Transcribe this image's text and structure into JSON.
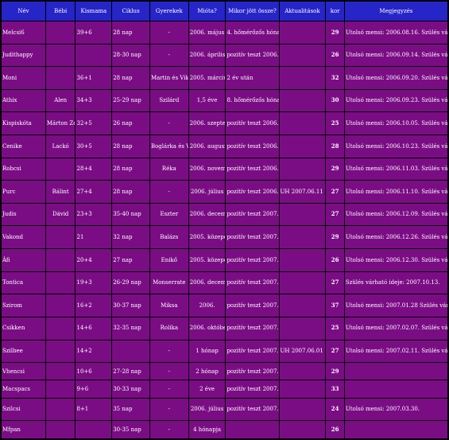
{
  "headers": [
    "Név",
    "Bébi",
    "Kismama",
    "Ciklus",
    "Gyerekek",
    "Mióta?",
    "Mikor jött össze?",
    "Aktualitások",
    "kor",
    "Megjegyzés"
  ],
  "rows": [
    {
      "nev": "Melcsi6",
      "bebi": "",
      "kismama": "39+6",
      "ciklus": "28 nap",
      "gyerekek": "-",
      "miota": "2006. május",
      "mikor": "4. hőmérőzős hónapban",
      "aktualitasok": "",
      "kor": "29",
      "megjegyzes": "Utolsó mensi: 2006.08.16. Szülés várható ideje: 2007.05.23."
    },
    {
      "nev": "Judithappy",
      "bebi": "",
      "kismama": "",
      "ciklus": "28-30 nap",
      "gyerekek": "-",
      "miota": "2006. április",
      "mikor": "pozitív teszt 2006.10.16",
      "aktualitasok": "",
      "kor": "26",
      "megjegyzes": "Utolsó mensi: 2006.09.14. Szülés várható ideje: 2007.06.21."
    },
    {
      "nev": "Moni",
      "bebi": "",
      "kismama": "36+1",
      "ciklus": "28 nap",
      "gyerekek": "Martin és Viki",
      "miota": "2005. március",
      "mikor": "2 év után",
      "aktualitasok": "",
      "kor": "32",
      "megjegyzes": "Utolsó mensi: 2006.09.20. Szülés várható ideje: 2007.06.27."
    },
    {
      "nev": "Athix",
      "bebi": "Alen",
      "kismama": "34+3",
      "ciklus": "25-29 nap",
      "gyerekek": "Szilárd",
      "miota": "1,5 éve",
      "mikor": "8. hőmérőzős hónapban",
      "aktualitasok": "",
      "kor": "30",
      "megjegyzes": "Utolsó mensi: 2006.09.23. Szülés várható ideje: 2007.06.30."
    },
    {
      "nev": "Kispiskóta",
      "bebi": "Márton Zétény",
      "kismama": "32+5",
      "ciklus": "26 nap",
      "gyerekek": "-",
      "miota": "2006. szeptember",
      "mikor": "pozitív teszt 2006.10.30",
      "aktualitasok": "",
      "kor": "25",
      "megjegyzes": "Utolsó mensi: 2006.10.05. Szülés várható ideje: 2007.07.12"
    },
    {
      "nev": "Cenike",
      "bebi": "Lackó",
      "kismama": "30+5",
      "ciklus": "28 nap",
      "gyerekek": "Boglárka és Viola",
      "miota": "2006. augusztus",
      "mikor": "pozitív teszt 2006.11.19.",
      "aktualitasok": "",
      "kor": "28",
      "megjegyzes": "Utolsó mensi: 2006.10.23. Szülés várható ideje: 2007.07.30."
    },
    {
      "nev": "Robcsi",
      "bebi": "",
      "kismama": "28+4",
      "ciklus": "28 nap",
      "gyerekek": "Réka",
      "miota": "2006. november",
      "mikor": "pozitív teszt 2006.12.02.",
      "aktualitasok": "",
      "kor": "29",
      "megjegyzes": "Utolsó mensi: 2006.11.03. Szülés várható ideje:2007.08.10."
    },
    {
      "nev": "Purc",
      "bebi": "Bálint",
      "kismama": "27+4",
      "ciklus": "28 nap",
      "gyerekek": "-",
      "miota": "2006. július",
      "mikor": "pozitív teszt 2006.12.09.",
      "aktualitasok": "UH 2007.06.11",
      "kor": "27",
      "megjegyzes": "Utolsó mensi: 2006.11.10. Szülés várható ideje:2007.08.17."
    },
    {
      "nev": "Judis",
      "bebi": "Dávid",
      "kismama": "23+3",
      "ciklus": "35-40 nap",
      "gyerekek": "Eszter",
      "miota": "2006. december",
      "mikor": "pozitív teszt 2007.01.09.",
      "aktualitasok": "",
      "kor": "27",
      "megjegyzes": "Utolsó mensi: 2006.12.09. Szülés várható ideje: 2007.09.15."
    },
    {
      "nev": "Vakond",
      "bebi": "",
      "kismama": "21",
      "ciklus": "32 nap",
      "gyerekek": "Balázs",
      "miota": "2005. közepe",
      "mikor": "pozitív teszt 2007.01.31.",
      "aktualitasok": "",
      "kor": "29",
      "megjegyzes": "Utolsó mensi: 2006.12.26. Szülés várható ideje: 2007.10.02."
    },
    {
      "nev": "Áfi",
      "bebi": "",
      "kismama": "20+4",
      "ciklus": "27 nap",
      "gyerekek": "Enikő",
      "miota": "2005. közepe",
      "mikor": "pozitív teszt 2007.01.30.",
      "aktualitasok": "",
      "kor": "26",
      "megjegyzes": "Utolsó mensi: 2006.12.30. Szülés várható ideje: 2007.10.06."
    },
    {
      "nev": "Tontica",
      "bebi": "",
      "kismama": "19+3",
      "ciklus": "26-29 nap",
      "gyerekek": "Monserrate",
      "miota": "2006. december",
      "mikor": "pozitív teszt 2007.02.02.",
      "aktualitasok": "",
      "kor": "27",
      "megjegyzes": "Szülés várható ideje: 2007.10.13."
    },
    {
      "nev": "Szirom",
      "bebi": "",
      "kismama": "16+2",
      "ciklus": "30-37 nap",
      "gyerekek": "Miksa",
      "miota": "2006.",
      "mikor": "pozitív teszt 2007.02.24",
      "aktualitasok": "",
      "kor": "37",
      "megjegyzes": "Utolsó mensi: 2007.01.28 Szülés várható ideje: 2007.11.04"
    },
    {
      "nev": "Csikken",
      "bebi": "",
      "kismama": "14+6",
      "ciklus": "32-35 nap",
      "gyerekek": "Rolika",
      "miota": "2006. október",
      "mikor": "pozitív teszt 2007.03.10",
      "aktualitasok": "",
      "kor": "25",
      "megjegyzes": "Utolsó mensi: 2007.02.07. Szülés várható ideje: 2007.11.14"
    },
    {
      "nev": "Szilbee",
      "bebi": "",
      "kismama": "14+2",
      "ciklus": "",
      "gyerekek": "-",
      "miota": "1 hónap",
      "mikor": "pozitív teszt 2007.03.12",
      "aktualitasok": "UH 2007.06.01",
      "kor": "27",
      "megjegyzes": "Utolsó mensi: 2007.02.11. Szülés várható ideje: 2007.11.18"
    },
    {
      "nev": "Vhencsi",
      "bebi": "",
      "kismama": "10+6",
      "ciklus": "27-28 nap",
      "gyerekek": "-",
      "miota": "2 hónap",
      "mikor": "pozitív teszt 2007.04.05",
      "aktualitasok": "",
      "kor": "29",
      "megjegyzes": ""
    },
    {
      "nev": "Macspacs",
      "bebi": "",
      "kismama": "9+6",
      "ciklus": "30-33 nap",
      "gyerekek": "-",
      "miota": "2 éve",
      "mikor": "pozitív teszt 2007.04.14",
      "aktualitasok": "",
      "kor": "33",
      "megjegyzes": ""
    },
    {
      "nev": "Szilcsi",
      "bebi": "",
      "kismama": "8+1",
      "ciklus": "35 nap",
      "gyerekek": "-",
      "miota": "2006. július",
      "mikor": "pozitív teszt 2007.04.19",
      "aktualitasok": "",
      "kor": "24",
      "megjegyzes": "Utolsó mensi: 2007.03.30."
    },
    {
      "nev": "Mfpan",
      "bebi": "",
      "kismama": "",
      "ciklus": "30-35 nap",
      "gyerekek": "-",
      "miota": "4 hónapja",
      "mikor": "",
      "aktualitasok": "",
      "kor": "26",
      "megjegyzes": ""
    }
  ],
  "colors": {
    "header_bg": "#2525c8",
    "row_bg": "#7a0d84",
    "grid": "#000000",
    "text": "#ffffff"
  }
}
